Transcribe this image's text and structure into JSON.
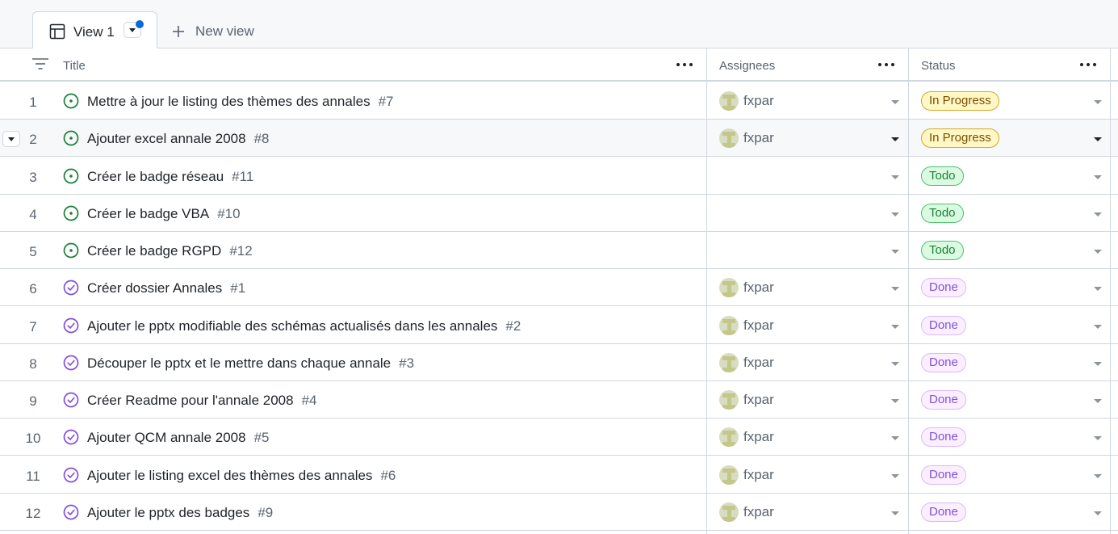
{
  "tabs": {
    "active_label": "View 1",
    "new_view_label": "New view"
  },
  "columns": {
    "title": "Title",
    "assignees": "Assignees",
    "status": "Status"
  },
  "colors": {
    "accent": "#0969da",
    "open_issue": "#1a7f37",
    "closed_issue": "#8250df"
  },
  "rows": [
    {
      "num": "1",
      "title": "Mettre à jour le listing des thèmes des annales",
      "issue": "#7",
      "state": "open",
      "assignee": "fxpar",
      "status": "In Progress"
    },
    {
      "num": "2",
      "title": "Ajouter excel annale 2008",
      "issue": "#8",
      "state": "open",
      "assignee": "fxpar",
      "status": "In Progress"
    },
    {
      "num": "3",
      "title": "Créer le badge réseau",
      "issue": "#11",
      "state": "open",
      "assignee": "",
      "status": "Todo"
    },
    {
      "num": "4",
      "title": "Créer le badge VBA",
      "issue": "#10",
      "state": "open",
      "assignee": "",
      "status": "Todo"
    },
    {
      "num": "5",
      "title": "Créer le badge RGPD",
      "issue": "#12",
      "state": "open",
      "assignee": "",
      "status": "Todo"
    },
    {
      "num": "6",
      "title": "Créer dossier Annales",
      "issue": "#1",
      "state": "closed",
      "assignee": "fxpar",
      "status": "Done"
    },
    {
      "num": "7",
      "title": "Ajouter le pptx modifiable des schémas actualisés dans les annales",
      "issue": "#2",
      "state": "closed",
      "assignee": "fxpar",
      "status": "Done"
    },
    {
      "num": "8",
      "title": "Découper le pptx et le mettre dans chaque annale",
      "issue": "#3",
      "state": "closed",
      "assignee": "fxpar",
      "status": "Done"
    },
    {
      "num": "9",
      "title": "Créer Readme pour l'annale 2008",
      "issue": "#4",
      "state": "closed",
      "assignee": "fxpar",
      "status": "Done"
    },
    {
      "num": "10",
      "title": "Ajouter QCM annale 2008",
      "issue": "#5",
      "state": "closed",
      "assignee": "fxpar",
      "status": "Done"
    },
    {
      "num": "11",
      "title": "Ajouter le listing excel des thèmes des annales",
      "issue": "#6",
      "state": "closed",
      "assignee": "fxpar",
      "status": "Done"
    },
    {
      "num": "12",
      "title": "Ajouter le pptx des badges",
      "issue": "#9",
      "state": "closed",
      "assignee": "fxpar",
      "status": "Done"
    }
  ]
}
